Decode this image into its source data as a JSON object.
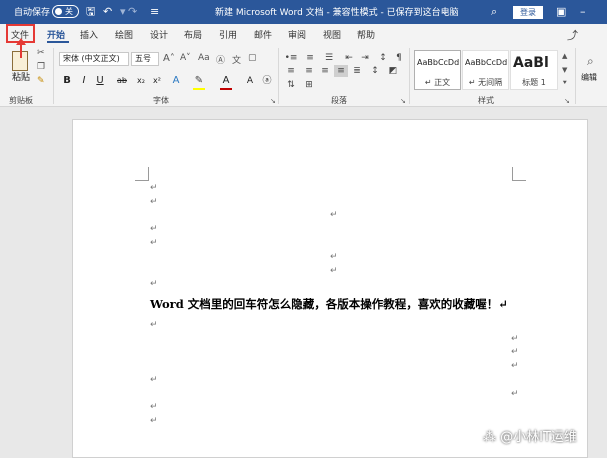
{
  "titlebar": {
    "autosave_label": "自动保存",
    "autosave_state": "关",
    "doc_title": "新建 Microsoft Word 文档 - 兼容性模式 - 已保存到这台电脑",
    "login_label": "登录"
  },
  "tabs": [
    "文件",
    "开始",
    "插入",
    "绘图",
    "设计",
    "布局",
    "引用",
    "邮件",
    "审阅",
    "视图",
    "帮助"
  ],
  "ribbon": {
    "clipboard": {
      "paste_label": "粘贴",
      "group_label": "剪贴板"
    },
    "font": {
      "font_name": "宋体 (中文正文)",
      "font_size": "五号",
      "group_label": "字体",
      "buttons": [
        "B",
        "I",
        "U",
        "ab",
        "x₂",
        "x²",
        "A",
        "A",
        "Aa"
      ]
    },
    "paragraph": {
      "group_label": "段落"
    },
    "styles": {
      "group_label": "样式",
      "items": [
        {
          "sample": "AaBbCcDd",
          "name": "↵ 正文"
        },
        {
          "sample": "AaBbCcDd",
          "name": "↵ 无间隔"
        },
        {
          "sample": "AaBl",
          "name": "标题 1"
        }
      ]
    },
    "editing": {
      "label": "编辑"
    }
  },
  "document": {
    "content": "Word 文档里的回车符怎么隐藏，各版本操作教程，喜欢的收藏喔！↵",
    "paragraph_mark": "↵"
  },
  "watermark": "⁂ @小林IT运维",
  "colors": {
    "titlebar": "#2b579a",
    "highlight": "#e53935",
    "font_color": "#c00000",
    "highlight_color": "#ffff00"
  }
}
